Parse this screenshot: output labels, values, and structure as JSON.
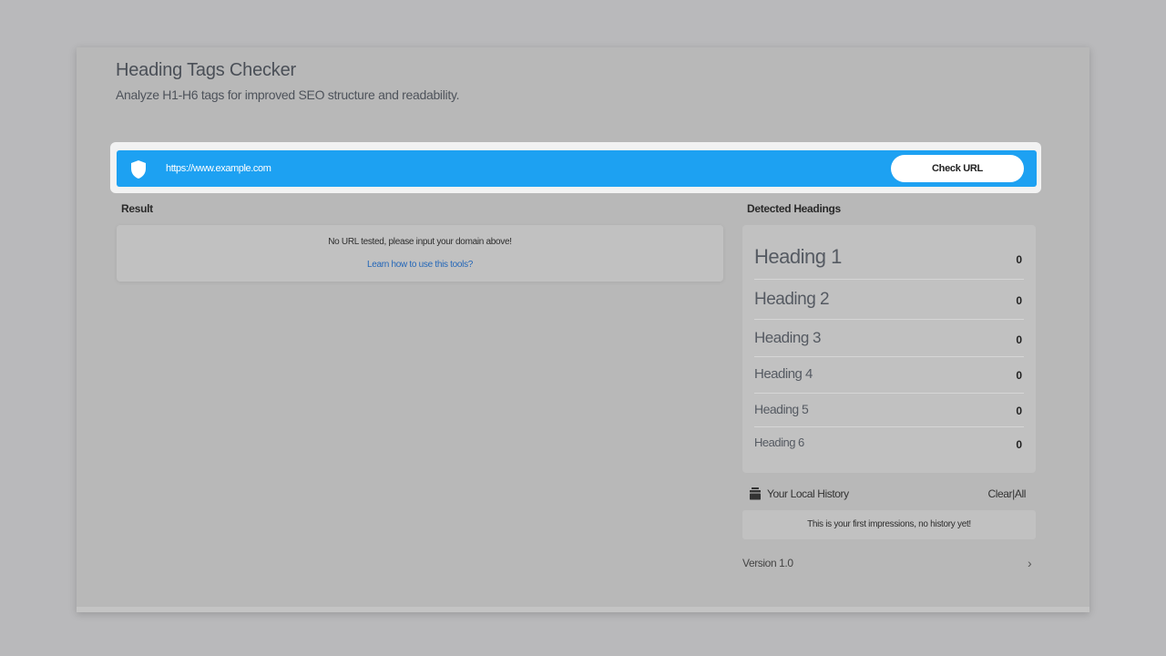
{
  "header": {
    "title": "Heading Tags Checker",
    "subtitle": "Analyze H1-H6 tags for improved SEO structure and readability."
  },
  "search": {
    "placeholder": "https://www.example.com",
    "value": "",
    "button_label": "Check URL"
  },
  "result": {
    "label": "Result",
    "message": "No URL tested, please input your domain above!",
    "link": "Learn how to use this tools?"
  },
  "headings": {
    "label": "Detected Headings",
    "items": [
      {
        "name": "Heading 1",
        "count": "0"
      },
      {
        "name": "Heading 2",
        "count": "0"
      },
      {
        "name": "Heading 3",
        "count": "0"
      },
      {
        "name": "Heading 4",
        "count": "0"
      },
      {
        "name": "Heading 5",
        "count": "0"
      },
      {
        "name": "Heading 6",
        "count": "0"
      }
    ]
  },
  "history": {
    "title": "Your Local History",
    "clear_label": "Clear|All",
    "message": "This is your first impressions, no history yet!"
  },
  "footer": {
    "version": "Version 1.0"
  },
  "colors": {
    "accent": "#1da1f2",
    "link": "#2467b8"
  },
  "icons": {
    "url_field": "shield-icon",
    "history": "archive-icon",
    "footer": "chevron-right-icon"
  }
}
